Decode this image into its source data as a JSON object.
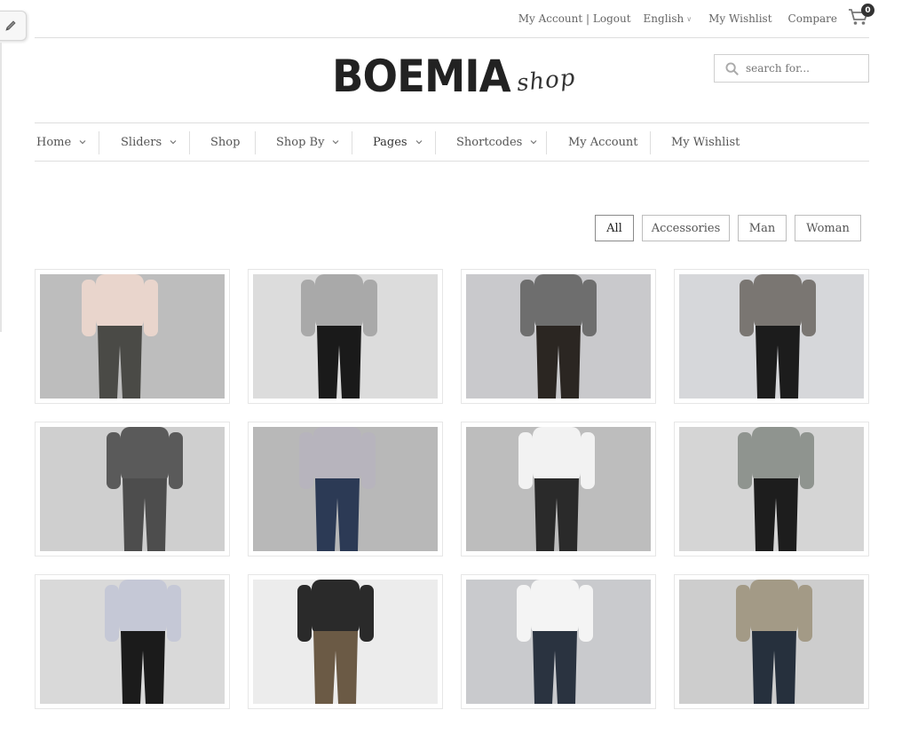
{
  "topbar": {
    "account_logout": "My Account | Logout",
    "language": "English",
    "wishlist": "My Wishlist",
    "compare": "Compare",
    "cart_count": "0"
  },
  "logo": {
    "main": "BOEMIA",
    "sub": "shop"
  },
  "search": {
    "placeholder": "search for..."
  },
  "nav": {
    "items": [
      {
        "label": "Home",
        "has_dropdown": true
      },
      {
        "label": "Sliders",
        "has_dropdown": true
      },
      {
        "label": "Shop",
        "has_dropdown": false
      },
      {
        "label": "Shop By",
        "has_dropdown": true
      },
      {
        "label": "Pages",
        "has_dropdown": true
      },
      {
        "label": "Shortcodes",
        "has_dropdown": true
      },
      {
        "label": "My Account",
        "has_dropdown": false
      },
      {
        "label": "My Wishlist",
        "has_dropdown": false
      }
    ]
  },
  "filters": {
    "items": [
      {
        "label": "All",
        "active": true
      },
      {
        "label": "Accessories",
        "active": false
      },
      {
        "label": "Man",
        "active": false
      },
      {
        "label": "Woman",
        "active": false
      }
    ]
  },
  "products": [
    {
      "bg": "#bdbdbd",
      "top": "#e9d5cc",
      "bottom": "#4a4a46"
    },
    {
      "bg": "#dcdcdc",
      "top": "#a9a9a9",
      "bottom": "#1a1a1a"
    },
    {
      "bg": "#c9c9cc",
      "top": "#6e6e6e",
      "bottom": "#2b2622"
    },
    {
      "bg": "#d6d7da",
      "top": "#7a7672",
      "bottom": "#1c1c1c"
    },
    {
      "bg": "#cfcfcf",
      "top": "#5a5a5a",
      "bottom": "#4d4d4d"
    },
    {
      "bg": "#b8b8b8",
      "top": "#b7b4bd",
      "bottom": "#2c3a55"
    },
    {
      "bg": "#bdbdbd",
      "top": "#f2f2f2",
      "bottom": "#2a2a2a"
    },
    {
      "bg": "#d5d5d5",
      "top": "#8f948f",
      "bottom": "#1d1d1d"
    },
    {
      "bg": "#d9d9d9",
      "top": "#c5c8d6",
      "bottom": "#1b1b1b"
    },
    {
      "bg": "#ececec",
      "top": "#2a2a2a",
      "bottom": "#6b5a45"
    },
    {
      "bg": "#c9cacd",
      "top": "#f4f4f4",
      "bottom": "#2a3340"
    },
    {
      "bg": "#cdcdcd",
      "top": "#a39a86",
      "bottom": "#26303d"
    }
  ]
}
